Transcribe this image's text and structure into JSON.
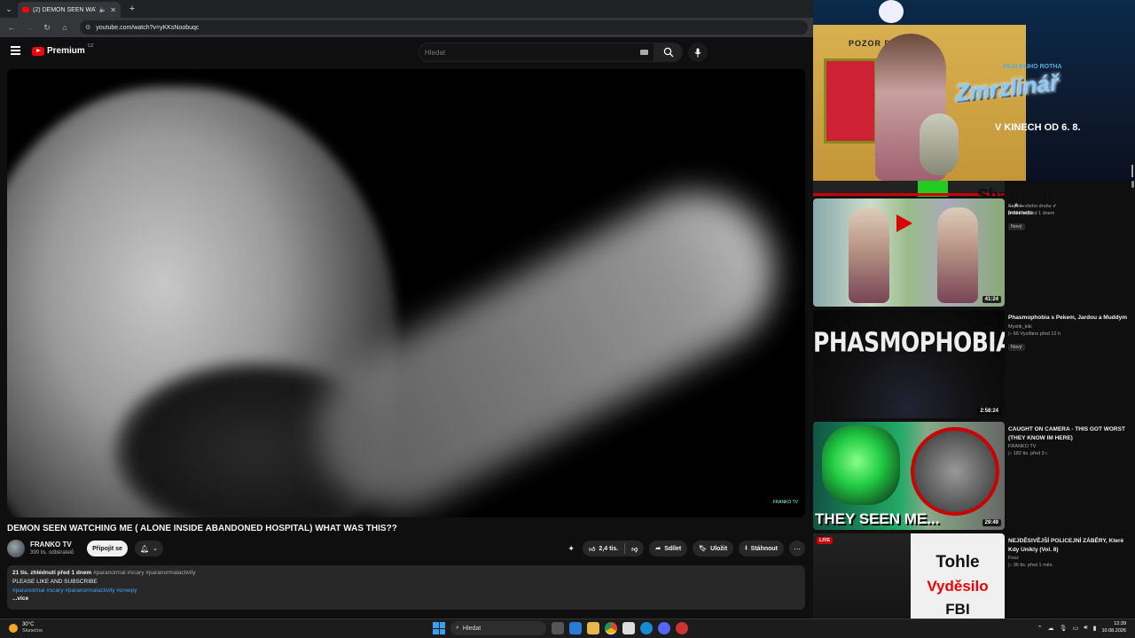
{
  "browser": {
    "tab_title": "(2) DEMON SEEN WATCHI...",
    "url": "youtube.com/watch?v=yKKsNoobuqc"
  },
  "header": {
    "logo_text": "Premium",
    "logo_country": "CZ",
    "search_placeholder": "Hledat"
  },
  "video": {
    "title": "DEMON SEEN WATCHING ME ( ALONE INSIDE ABANDONED HOSPITAL) WHAT WAS THIS??",
    "watermark": "FRANKO TV",
    "channel_name": "FRANKO TV",
    "subscribers": "399 tis. odběratelů",
    "join_label": "Připojit se",
    "likes": "2,4 tis.",
    "share_label": "Sdílet",
    "save_label": "Uložit",
    "download_label": "Stáhnout"
  },
  "description": {
    "stats": "21 tis. zhlédnutí  před 1 dnem",
    "tags_inline": "#paranormal #scary #paranormalactivity",
    "line1": "PLEASE LIKE AND SUBSCRIBE",
    "links": "#paranormal #scary #paranormalactivity #creepy",
    "more": "...více"
  },
  "ad": {
    "sign": "POZOR DĚTI",
    "film": "FILM ELIHO ROTHA",
    "title": "Zmrzlinář",
    "date": "V KINECH OD 6. 8."
  },
  "related_top": {
    "overlay_text": "Shadowtix",
    "title_tail": "... a ...",
    "title_tail_2": "Internetu"
  },
  "related": [
    {
      "title": "",
      "channel": "Sajdok všeho druhu",
      "meta": "▷ 11 tis.  před 1 dnem",
      "badge": "Nový",
      "duration": "41:24"
    },
    {
      "title": "Phasmophobia s Pekem, Jardou a Muddym",
      "channel": "Mystik_kiki",
      "meta": "▷ 66  Vysíláno před 12 h",
      "badge": "Nový",
      "duration": "2:58:24",
      "thumb_text": "PHASMOPHOBIA"
    },
    {
      "title": "CAUGHT ON CAMERA - THIS GOT WORST (THEY KNOW IM HERE)",
      "channel": "FRANKO TV",
      "meta": "▷ 182 tis.  před 3 r.",
      "duration": "29:49",
      "thumb_text": "THEY SEEN ME..."
    },
    {
      "title": "NEJDĚSIVĚJŠÍ POLICEJNÍ ZÁBĚRY, Které Kdy Unikly (Vol. 8)",
      "channel": "Frizz",
      "meta": "▷ 36 tis.  před 1 měs.",
      "live": "LIVE",
      "thumb_w1": "Tohle",
      "thumb_w2": "Vyděsilo",
      "thumb_w3": "FBI"
    }
  ],
  "taskbar": {
    "temp": "30°C",
    "condition": "Slunečno",
    "search": "Hledat",
    "time": "12:39",
    "date": "10.08.2026"
  }
}
